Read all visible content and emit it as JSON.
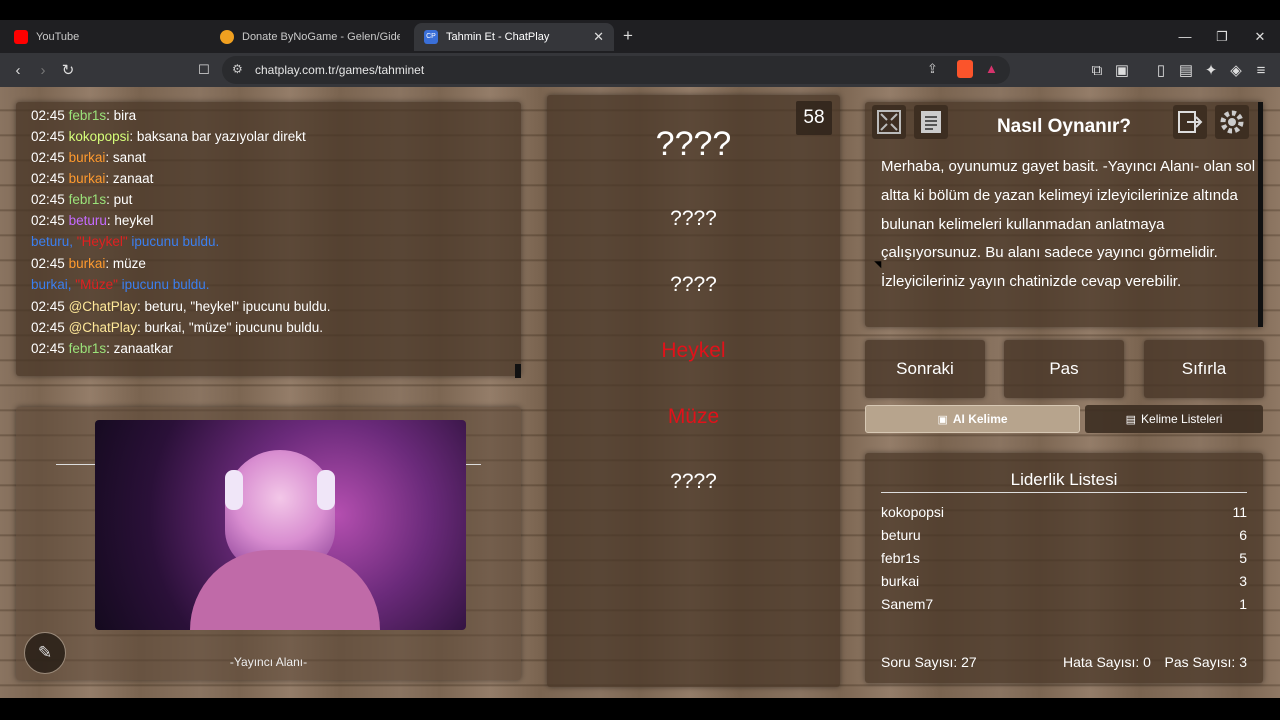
{
  "browser": {
    "tabs": [
      {
        "title": "YouTube",
        "color": "#ff0000"
      },
      {
        "title": "Donate ByNoGame - Gelen/Giden Ba",
        "color": "#f0a020"
      },
      {
        "title": "Tahmin Et - ChatPlay",
        "color": "#3a6fd8"
      }
    ],
    "url": "chatplay.com.tr/games/tahminet"
  },
  "chat": {
    "lines": [
      {
        "time": "02:45",
        "user": "febr1s",
        "user_color": "#9be37a",
        "msg": ": bira"
      },
      {
        "time": "02:45",
        "user": "kokopopsi",
        "user_color": "#d6ff7a",
        "msg": ": baksana bar yazıyolar direkt"
      },
      {
        "time": "02:45",
        "user": "burkai",
        "user_color": "#ff9a2e",
        "msg": ": sanat"
      },
      {
        "time": "02:45",
        "user": "burkai",
        "user_color": "#ff9a2e",
        "msg": ": zanaat"
      },
      {
        "time": "02:45",
        "user": "febr1s",
        "user_color": "#9be37a",
        "msg": ": put"
      },
      {
        "time": "02:45",
        "user": "beturu",
        "user_color": "#c56bff",
        "msg": ": heykel"
      },
      {
        "found_user": "beturu",
        "found_word": "\"Heykel\"",
        "found_text": " ipucunu buldu."
      },
      {
        "time": "02:45",
        "user": "burkai",
        "user_color": "#ff9a2e",
        "msg": ": müze"
      },
      {
        "found_user": "burkai",
        "found_word": "\"Müze\"",
        "found_text": " ipucunu buldu."
      },
      {
        "time": "02:45",
        "user": "@ChatPlay",
        "user_color": "#ffe99a",
        "msg": ": beturu, \"heykel\" ipucunu buldu."
      },
      {
        "time": "02:45",
        "user": "@ChatPlay",
        "user_color": "#ffe99a",
        "msg": ": burkai, \"müze\" ipucunu buldu."
      },
      {
        "time": "02:45",
        "user": "febr1s",
        "user_color": "#9be37a",
        "msg": ": zanaatkar"
      }
    ]
  },
  "streamer": {
    "label": "-Yayıncı Alanı-"
  },
  "words": {
    "timer": "58",
    "main": "????",
    "items": [
      "????",
      "????",
      "Heykel",
      "Müze",
      "????"
    ]
  },
  "howto": {
    "title": "Nasıl Oynanır?",
    "text": "Merhaba, oyunumuz gayet basit. -Yayıncı Alanı- olan sol altta ki bölüm de yazan kelimeyi izleyicilerinize altında bulunan kelimeleri kullanmadan anlatmaya çalışıyorsunuz. Bu alanı sadece yayıncı görmelidir. İzleyicileriniz yayın chatinizde cevap verebilir."
  },
  "controls": {
    "next": "Sonraki",
    "pass": "Pas",
    "reset": "Sıfırla",
    "ai_word": "AI Kelime",
    "word_lists": "Kelime Listeleri"
  },
  "leaderboard": {
    "title": "Liderlik Listesi",
    "rows": [
      {
        "name": "kokopopsi",
        "score": "11"
      },
      {
        "name": "beturu",
        "score": "6"
      },
      {
        "name": "febr1s",
        "score": "5"
      },
      {
        "name": "burkai",
        "score": "3"
      },
      {
        "name": "Sanem7",
        "score": "1"
      }
    ],
    "question_count": "Soru Sayısı: 27",
    "error_count": "Hata Sayısı: 0",
    "pass_count": "Pas Sayısı: 3"
  }
}
